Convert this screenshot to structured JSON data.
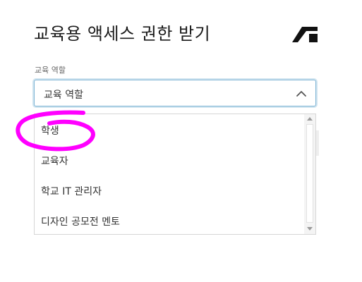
{
  "dialog": {
    "title": "교육용 액세스 권한 받기",
    "logo_icon": "autodesk-logo-icon"
  },
  "role_field": {
    "label": "교육 역할",
    "selected_value": "교육 역할",
    "expanded": true
  },
  "dropdown": {
    "options": [
      {
        "label": "학생"
      },
      {
        "label": "교육자"
      },
      {
        "label": "학교 IT 관리자"
      },
      {
        "label": "디자인 공모전 멘토"
      }
    ]
  },
  "colors": {
    "focus_border": "#7fb5d5",
    "annotation_stroke": "#ff00ff",
    "logo": "#111111"
  }
}
